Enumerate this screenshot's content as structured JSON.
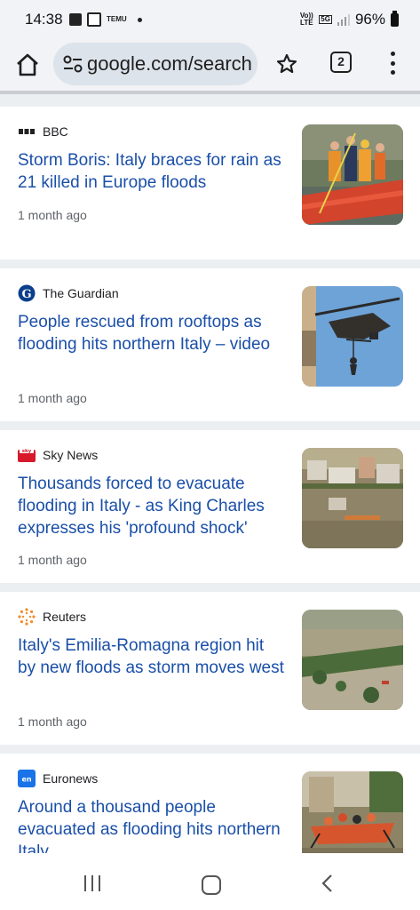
{
  "status_bar": {
    "time": "14:38",
    "temu_label": "TEMU",
    "volte_label": "Vo)) LTE",
    "network_label": "5G",
    "battery": "96%"
  },
  "toolbar": {
    "url": "google.com/search",
    "tab_count": "2"
  },
  "articles": [
    {
      "source": "BBC",
      "headline": "Storm Boris: Italy braces for rain as 21 killed in Europe floods",
      "time": "1 month ago",
      "thumb_desc": "rescuers in orange boat"
    },
    {
      "source": "The Guardian",
      "headline": "People rescued from rooftops as flooding hits northern Italy – video",
      "time": "1 month ago",
      "thumb_desc": "helicopter winch rescue"
    },
    {
      "source": "Sky News",
      "headline": "Thousands forced to evacuate flooding in Italy - as King Charles expresses his 'profound shock'",
      "time": "1 month ago",
      "thumb_desc": "flooded town aerial"
    },
    {
      "source": "Reuters",
      "headline": "Italy's Emilia-Romagna region hit by new floods as storm moves west",
      "time": "1 month ago",
      "thumb_desc": "flooded fields aerial"
    },
    {
      "source": "Euronews",
      "headline": "Around a thousand people evacuated as flooding hits northern Italy",
      "time": "",
      "thumb_desc": "rescue raft in flooded street"
    }
  ],
  "colors": {
    "headline": "#1a4fa8",
    "chrome_bg": "#f1f3f7",
    "url_bar_bg": "#dde3ea"
  }
}
